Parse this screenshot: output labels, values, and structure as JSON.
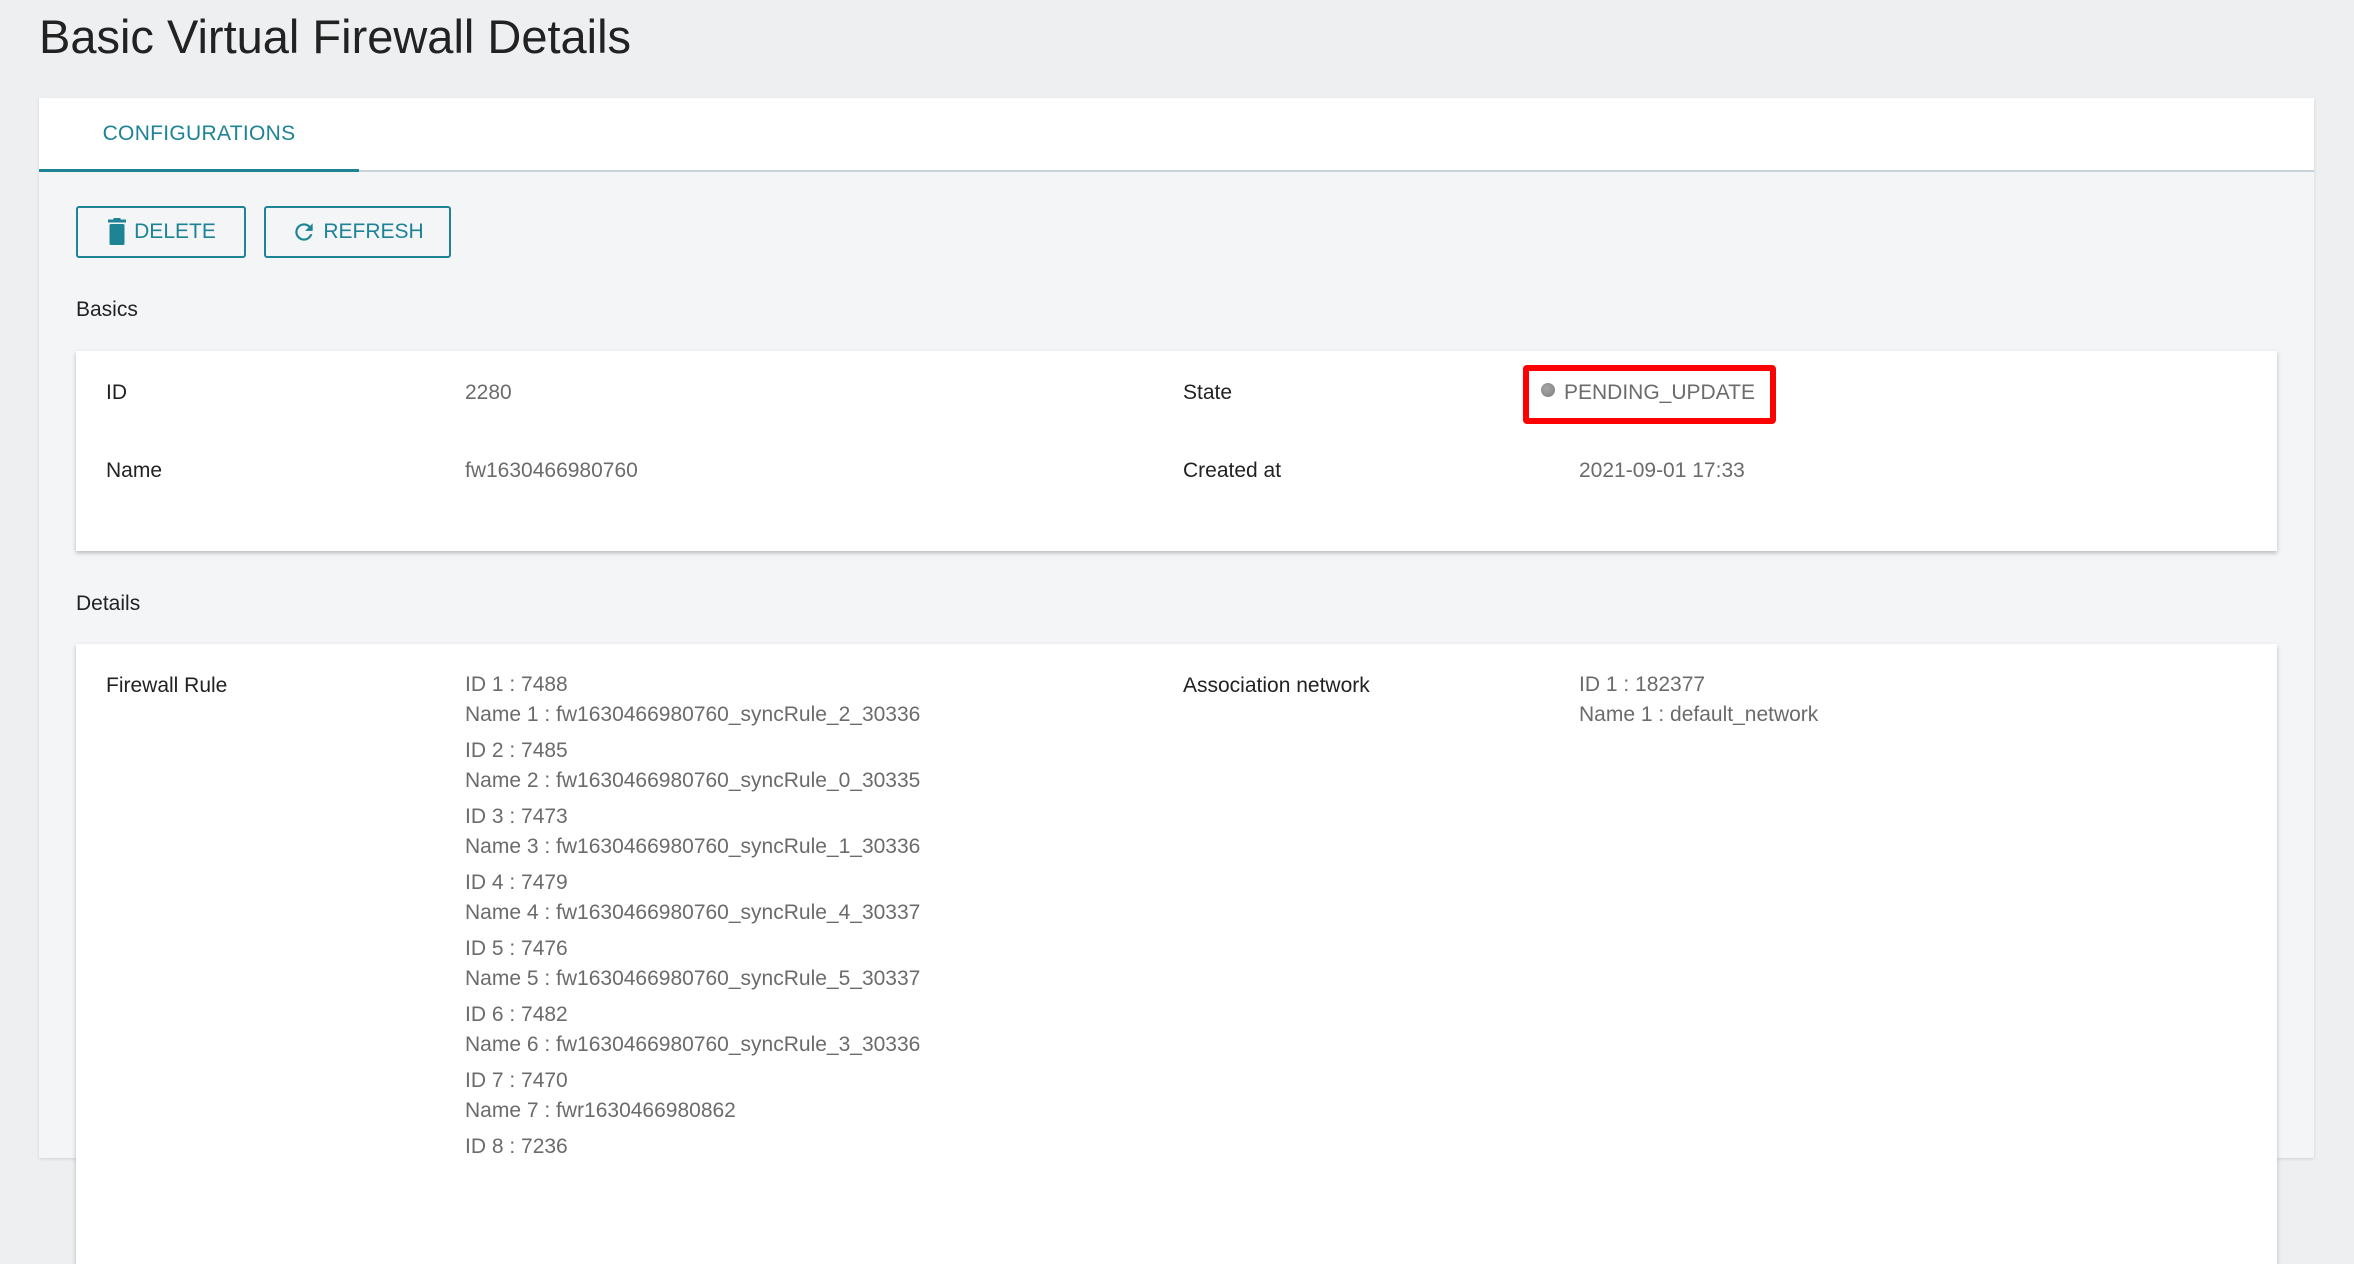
{
  "page": {
    "title": "Basic Virtual Firewall Details"
  },
  "tabs": [
    {
      "label": "CONFIGURATIONS",
      "active": true
    }
  ],
  "toolbar": {
    "delete_label": "DELETE",
    "delete_icon": "trash-icon",
    "refresh_label": "REFRESH",
    "refresh_icon": "refresh-icon"
  },
  "basics": {
    "section_label": "Basics",
    "id_label": "ID",
    "id_value": "2280",
    "name_label": "Name",
    "name_value": "fw1630466980760",
    "state_label": "State",
    "state_value": "PENDING_UPDATE",
    "state_color": "#8a8a8a",
    "highlight_color": "#ff0000",
    "created_label": "Created at",
    "created_value": "2021-09-01 17:33"
  },
  "details": {
    "section_label": "Details",
    "firewall_rule_label": "Firewall Rule",
    "firewall_rules": [
      {
        "id_line": "ID 1 : 7488",
        "name_line": "Name 1 : fw1630466980760_syncRule_2_30336"
      },
      {
        "id_line": "ID 2 : 7485",
        "name_line": "Name 2 : fw1630466980760_syncRule_0_30335"
      },
      {
        "id_line": "ID 3 : 7473",
        "name_line": "Name 3 : fw1630466980760_syncRule_1_30336"
      },
      {
        "id_line": "ID 4 : 7479",
        "name_line": "Name 4 : fw1630466980760_syncRule_4_30337"
      },
      {
        "id_line": "ID 5 : 7476",
        "name_line": "Name 5 : fw1630466980760_syncRule_5_30337"
      },
      {
        "id_line": "ID 6 : 7482",
        "name_line": "Name 6 : fw1630466980760_syncRule_3_30336"
      },
      {
        "id_line": "ID 7 : 7470",
        "name_line": "Name 7 : fwr1630466980862"
      },
      {
        "id_line": "ID 8 : 7236",
        "name_line": ""
      }
    ],
    "association_label": "Association network",
    "association_networks": [
      {
        "id_line": "ID 1 : 182377",
        "name_line": "Name 1 : default_network"
      }
    ]
  },
  "colors": {
    "accent": "#1d8395",
    "background": "#eeeff1",
    "panel": "#ffffff"
  }
}
